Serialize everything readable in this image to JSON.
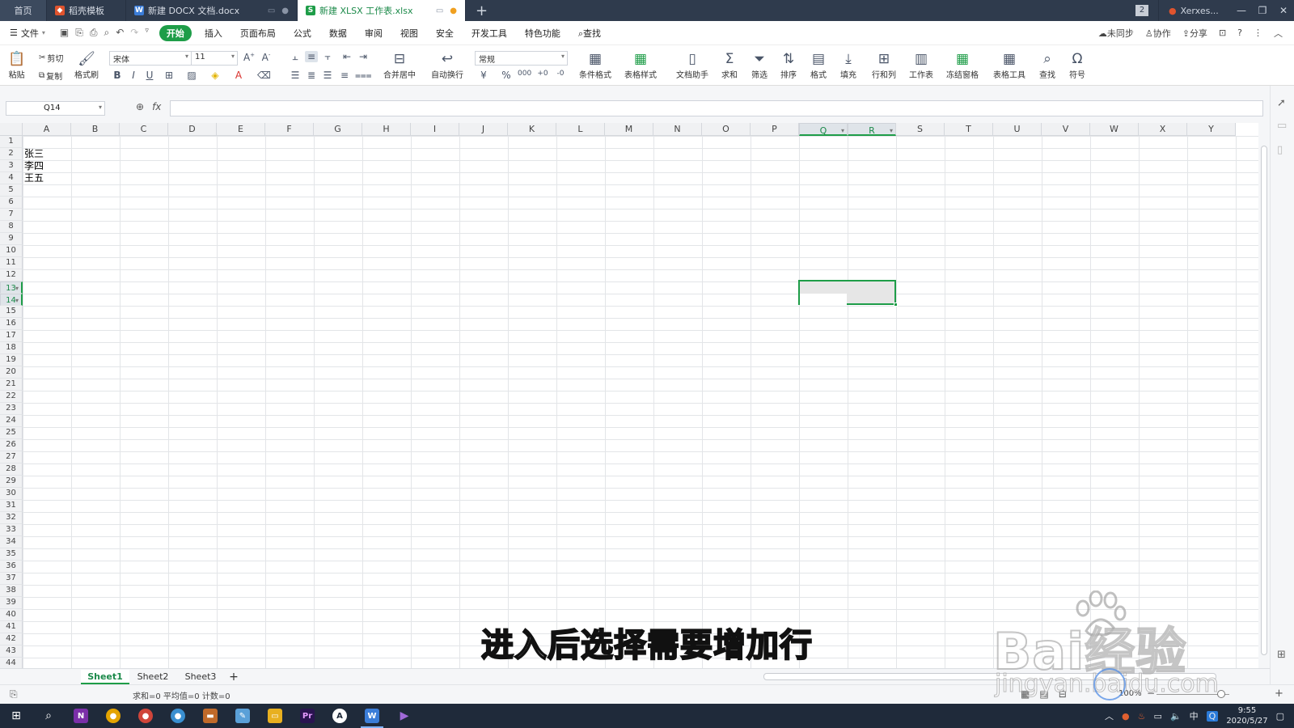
{
  "tabs": {
    "home": "首页",
    "template": "稻壳模板",
    "docx": "新建 DOCX 文档.docx",
    "xlsx": "新建 XLSX 工作表.xlsx",
    "window_count": "2",
    "account": "Xerxes..."
  },
  "menu": {
    "file": "文件",
    "items": [
      "开始",
      "插入",
      "页面布局",
      "公式",
      "数据",
      "审阅",
      "视图",
      "安全",
      "开发工具",
      "特色功能"
    ],
    "search": "查找",
    "sync": "未同步",
    "collab": "协作",
    "share": "分享",
    "help": "?"
  },
  "ribbon": {
    "paste": "粘贴",
    "cut": "剪切",
    "copy": "复制",
    "format_painter": "格式刷",
    "font_name": "宋体",
    "font_size": "11",
    "merge_center": "合并居中",
    "wrap_text": "自动换行",
    "number_format": "常规",
    "cond_format": "条件格式",
    "table_style": "表格样式",
    "doc_helper": "文档助手",
    "sum": "求和",
    "filter": "筛选",
    "sort": "排序",
    "format": "格式",
    "fill": "填充",
    "row_col": "行和列",
    "worksheet": "工作表",
    "freeze": "冻结窗格",
    "table_tools": "表格工具",
    "find": "查找",
    "symbol": "符号"
  },
  "formula_bar": {
    "name_box": "Q14",
    "fx": "fx",
    "content": ""
  },
  "grid": {
    "columns": [
      "A",
      "B",
      "C",
      "D",
      "E",
      "F",
      "G",
      "H",
      "I",
      "J",
      "K",
      "L",
      "M",
      "N",
      "O",
      "P",
      "Q",
      "R",
      "S",
      "T",
      "U",
      "V",
      "W",
      "X",
      "Y"
    ],
    "selected_columns": [
      "Q",
      "R"
    ],
    "rows": [
      "1",
      "2",
      "3",
      "4",
      "5",
      "6",
      "7",
      "8",
      "9",
      "10",
      "11",
      "12",
      "13",
      "14",
      "15",
      "16",
      "17",
      "18",
      "19",
      "20",
      "21",
      "22",
      "23",
      "24",
      "25",
      "26",
      "27",
      "28",
      "29",
      "30",
      "31",
      "32",
      "33",
      "34",
      "35",
      "36",
      "37",
      "38",
      "39",
      "40",
      "41",
      "42",
      "43",
      "44"
    ],
    "selected_rows": [
      "13",
      "14"
    ],
    "cells": [
      {
        "ref": "A2",
        "row": 2,
        "value": "张三"
      },
      {
        "ref": "A3",
        "row": 3,
        "value": "李四"
      },
      {
        "ref": "A4",
        "row": 4,
        "value": "王五"
      }
    ]
  },
  "sheets": {
    "tabs": [
      "Sheet1",
      "Sheet2",
      "Sheet3"
    ],
    "active": "Sheet1"
  },
  "status": {
    "summary": "求和=0  平均值=0  计数=0",
    "zoom": "100%"
  },
  "taskbar": {
    "time": "9:55",
    "date": "2020/5/27",
    "ime": "中"
  },
  "overlay": {
    "subtitle": "进入后选择需要增加行",
    "watermark": "Bai经验",
    "watermark_url": "jingyan.baidu.com"
  },
  "colors": {
    "accent": "#1e9d48",
    "tabbar": "#2f3b4d",
    "taskbar": "#1f2a3a"
  }
}
